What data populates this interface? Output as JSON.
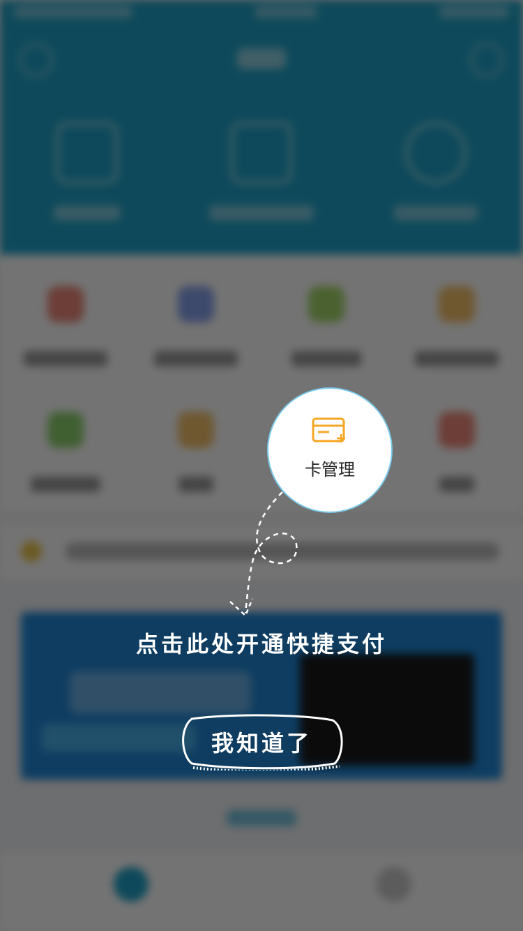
{
  "spotlight": {
    "label": "卡管理",
    "icon": "credit-card-add-icon",
    "accent": "#f5a623"
  },
  "hint": {
    "text": "点击此处开通快捷支付"
  },
  "dismiss_button": {
    "label": "我知道了"
  },
  "colors": {
    "header": "#1ea3c9",
    "overlay": "rgba(0,0,0,0.55)",
    "banner": "#1f87d8"
  }
}
